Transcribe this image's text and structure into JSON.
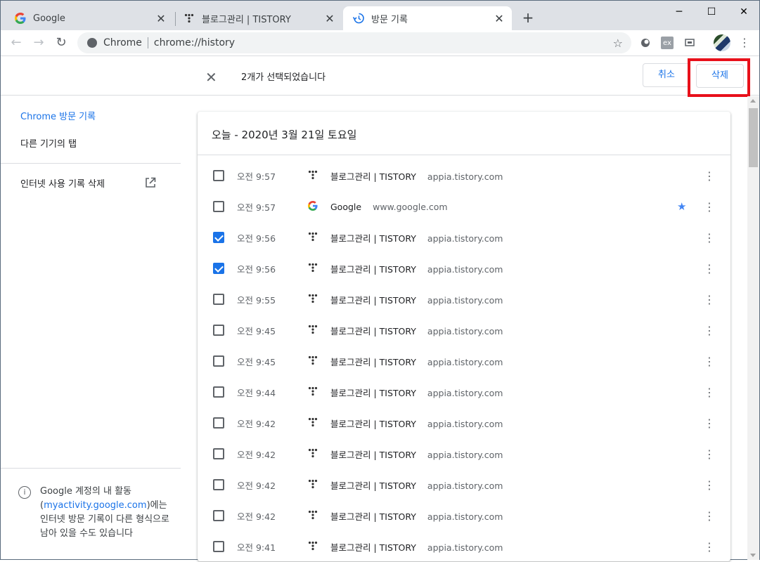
{
  "tabs": [
    {
      "label": "Google",
      "icon": "google-g-icon"
    },
    {
      "label": "블로그관리 | TISTORY",
      "icon": "tistory-icon"
    },
    {
      "label": "방문 기록",
      "icon": "history-icon"
    }
  ],
  "window": {
    "minimize": "─",
    "maximize": "☐",
    "close": "✕"
  },
  "omnibox": {
    "site": "Chrome",
    "url": "chrome://history"
  },
  "selection": {
    "count_text": "2개가 선택되었습니다",
    "cancel_label": "취소",
    "delete_label": "삭제"
  },
  "sidebar": {
    "active": "Chrome 방문 기록",
    "other_devices": "다른 기기의 탭",
    "clear_data": "인터넷 사용 기록 삭제",
    "footer_pre": "Google 계정의 내 활동 (",
    "footer_link": "myactivity.google.com",
    "footer_post": ")에는 인터넷 방문 기록이 다른 형식으로 남아 있을 수도 있습니다"
  },
  "history": {
    "date_title": "오늘 - 2020년 3월 21일 토요일",
    "rows": [
      {
        "time": "오전 9:57",
        "title": "블로그관리 | TISTORY",
        "domain": "appia.tistory.com",
        "checked": false,
        "bookmarked": false,
        "icon": "tistory-icon"
      },
      {
        "time": "오전 9:57",
        "title": "Google",
        "domain": "www.google.com",
        "checked": false,
        "bookmarked": true,
        "icon": "google-g-icon"
      },
      {
        "time": "오전 9:56",
        "title": "블로그관리 | TISTORY",
        "domain": "appia.tistory.com",
        "checked": true,
        "bookmarked": false,
        "icon": "tistory-icon"
      },
      {
        "time": "오전 9:56",
        "title": "블로그관리 | TISTORY",
        "domain": "appia.tistory.com",
        "checked": true,
        "bookmarked": false,
        "icon": "tistory-icon"
      },
      {
        "time": "오전 9:55",
        "title": "블로그관리 | TISTORY",
        "domain": "appia.tistory.com",
        "checked": false,
        "bookmarked": false,
        "icon": "tistory-icon"
      },
      {
        "time": "오전 9:45",
        "title": "블로그관리 | TISTORY",
        "domain": "appia.tistory.com",
        "checked": false,
        "bookmarked": false,
        "icon": "tistory-icon"
      },
      {
        "time": "오전 9:45",
        "title": "블로그관리 | TISTORY",
        "domain": "appia.tistory.com",
        "checked": false,
        "bookmarked": false,
        "icon": "tistory-icon"
      },
      {
        "time": "오전 9:44",
        "title": "블로그관리 | TISTORY",
        "domain": "appia.tistory.com",
        "checked": false,
        "bookmarked": false,
        "icon": "tistory-icon"
      },
      {
        "time": "오전 9:42",
        "title": "블로그관리 | TISTORY",
        "domain": "appia.tistory.com",
        "checked": false,
        "bookmarked": false,
        "icon": "tistory-icon"
      },
      {
        "time": "오전 9:42",
        "title": "블로그관리 | TISTORY",
        "domain": "appia.tistory.com",
        "checked": false,
        "bookmarked": false,
        "icon": "tistory-icon"
      },
      {
        "time": "오전 9:42",
        "title": "블로그관리 | TISTORY",
        "domain": "appia.tistory.com",
        "checked": false,
        "bookmarked": false,
        "icon": "tistory-icon"
      },
      {
        "time": "오전 9:42",
        "title": "블로그관리 | TISTORY",
        "domain": "appia.tistory.com",
        "checked": false,
        "bookmarked": false,
        "icon": "tistory-icon"
      },
      {
        "time": "오전 9:41",
        "title": "블로그관리 | TISTORY",
        "domain": "appia.tistory.com",
        "checked": false,
        "bookmarked": false,
        "icon": "tistory-icon"
      }
    ]
  },
  "colors": {
    "accent": "#1a73e8",
    "highlight": "#e8101a",
    "bookmark": "#4285f4"
  }
}
